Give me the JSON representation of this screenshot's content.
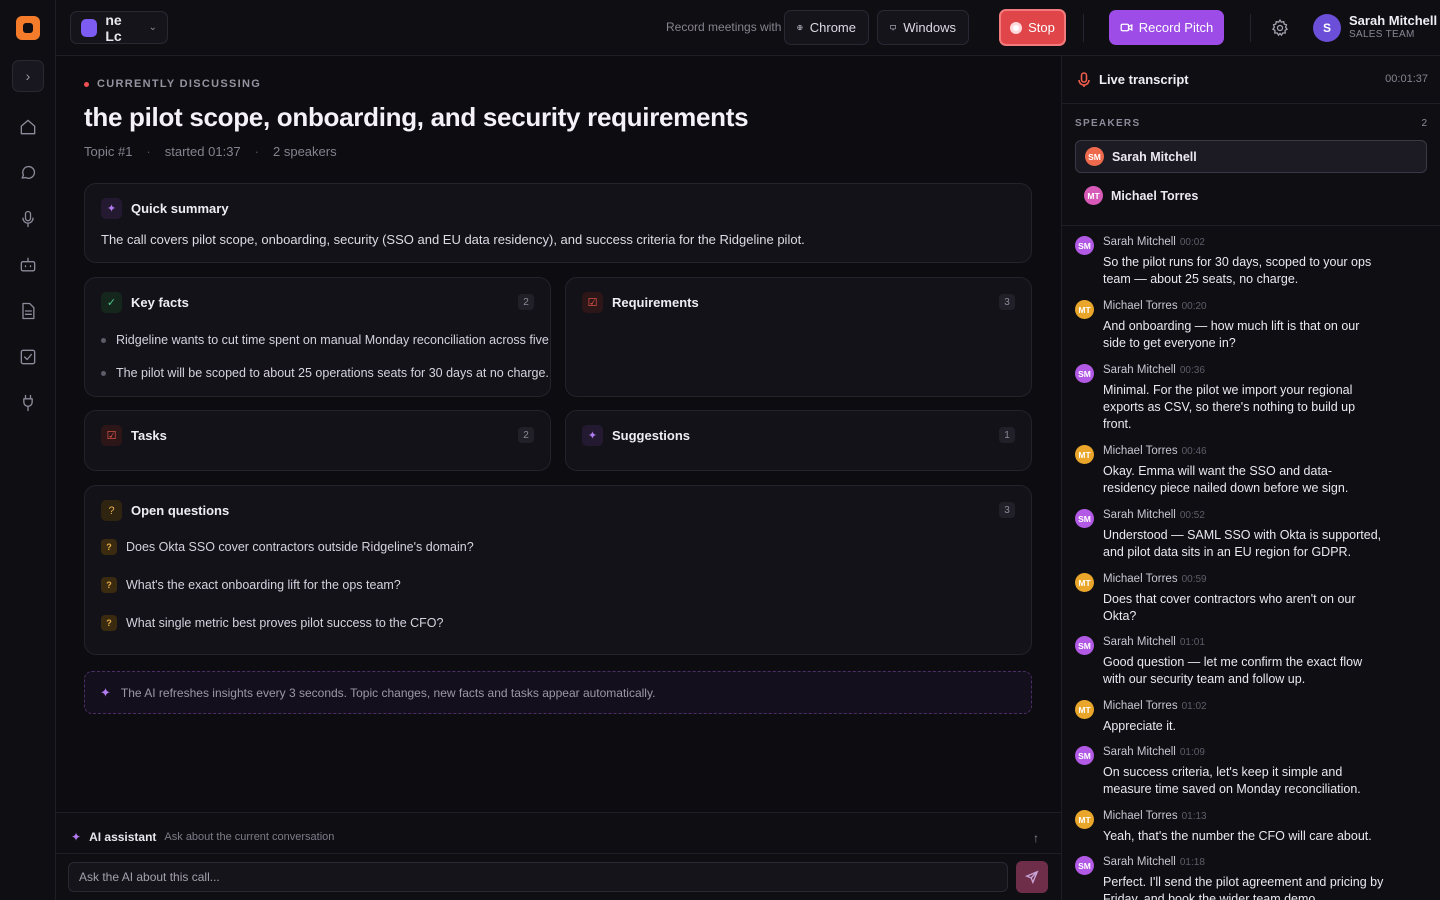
{
  "workspace": {
    "label": "ne Lc"
  },
  "topbar": {
    "record_label": "Record meetings with",
    "chrome_label": "Chrome",
    "windows_label": "Windows",
    "stop_label": "Stop",
    "pitch_label": "Record Pitch",
    "user_initial": "S",
    "user_name": "Sarah Mitchell",
    "user_team": "SALES TEAM"
  },
  "main": {
    "eyebrow": "CURRENTLY DISCUSSING",
    "title": "the pilot scope, onboarding, and security requirements",
    "topic": "Topic #1",
    "started": "started 01:37",
    "speakers": "2 speakers",
    "sep": "·",
    "summary": {
      "title": "Quick summary",
      "text": "The call covers pilot scope, onboarding, security (SSO and EU data residency), and success criteria for the Ridgeline pilot."
    },
    "key_facts": {
      "title": "Key facts",
      "count": "2",
      "items": [
        "Ridgeline wants to cut time spent on manual Monday reconciliation across five regio",
        "The pilot will be scoped to about 25 operations seats for 30 days at no charge."
      ]
    },
    "requirements": {
      "title": "Requirements",
      "count": "3"
    },
    "tasks": {
      "title": "Tasks",
      "count": "2"
    },
    "suggestions": {
      "title": "Suggestions",
      "count": "1"
    },
    "open_questions": {
      "title": "Open questions",
      "count": "3",
      "badge": "?",
      "items": [
        "Does Okta SSO cover contractors outside Ridgeline's domain?",
        "What's the exact onboarding lift for the ops team?",
        "What single metric best proves pilot success to the CFO?"
      ]
    },
    "ai_note": "The AI refreshes insights every 3 seconds. Topic changes, new facts and tasks appear automatically."
  },
  "assistant": {
    "title": "AI assistant",
    "subtitle": "Ask about the current conversation",
    "placeholder": "Ask the AI about this call..."
  },
  "transcript": {
    "title": "Live transcript",
    "timer": "00:01:37",
    "speakers_label": "SPEAKERS",
    "speakers_count": "2",
    "speakers": [
      {
        "initials": "SM",
        "name": "Sarah Mitchell"
      },
      {
        "initials": "MT",
        "name": "Michael Torres"
      }
    ],
    "messages": [
      {
        "initials": "SM",
        "name": "Sarah Mitchell",
        "time": "00:02",
        "text": "So the pilot runs for 30 days, scoped to your ops team — about 25 seats, no charge."
      },
      {
        "initials": "MT",
        "name": "Michael Torres",
        "time": "00:20",
        "text": "And onboarding — how much lift is that on our side to get everyone in?"
      },
      {
        "initials": "SM",
        "name": "Sarah Mitchell",
        "time": "00:36",
        "text": "Minimal. For the pilot we import your regional exports as CSV, so there's nothing to build up front."
      },
      {
        "initials": "MT",
        "name": "Michael Torres",
        "time": "00:46",
        "text": "Okay. Emma will want the SSO and data-residency piece nailed down before we sign."
      },
      {
        "initials": "SM",
        "name": "Sarah Mitchell",
        "time": "00:52",
        "text": "Understood — SAML SSO with Okta is supported, and pilot data sits in an EU region for GDPR."
      },
      {
        "initials": "MT",
        "name": "Michael Torres",
        "time": "00:59",
        "text": "Does that cover contractors who aren't on our Okta?"
      },
      {
        "initials": "SM",
        "name": "Sarah Mitchell",
        "time": "01:01",
        "text": "Good question — let me confirm the exact flow with our security team and follow up."
      },
      {
        "initials": "MT",
        "name": "Michael Torres",
        "time": "01:02",
        "text": "Appreciate it."
      },
      {
        "initials": "SM",
        "name": "Sarah Mitchell",
        "time": "01:09",
        "text": "On success criteria, let's keep it simple and measure time saved on Monday reconciliation."
      },
      {
        "initials": "MT",
        "name": "Michael Torres",
        "time": "01:13",
        "text": "Yeah, that's the number the CFO will care about."
      },
      {
        "initials": "SM",
        "name": "Sarah Mitchell",
        "time": "01:18",
        "text": "Perfect. I'll send the pilot agreement and pricing by Friday, and book the wider team demo."
      }
    ]
  },
  "colors": {
    "background": "#0d0c10",
    "stop": "#e0454a",
    "pitch": "#9d4ce8",
    "accent_orange": "#f47b2a",
    "avatar_sm": "#b25ae6",
    "avatar_mt": "#e9a62a"
  },
  "icons": {
    "rail": [
      "home-icon",
      "chat-icon",
      "microphone-icon",
      "bot-icon",
      "document-icon",
      "checkbox-icon",
      "plug-icon"
    ]
  }
}
